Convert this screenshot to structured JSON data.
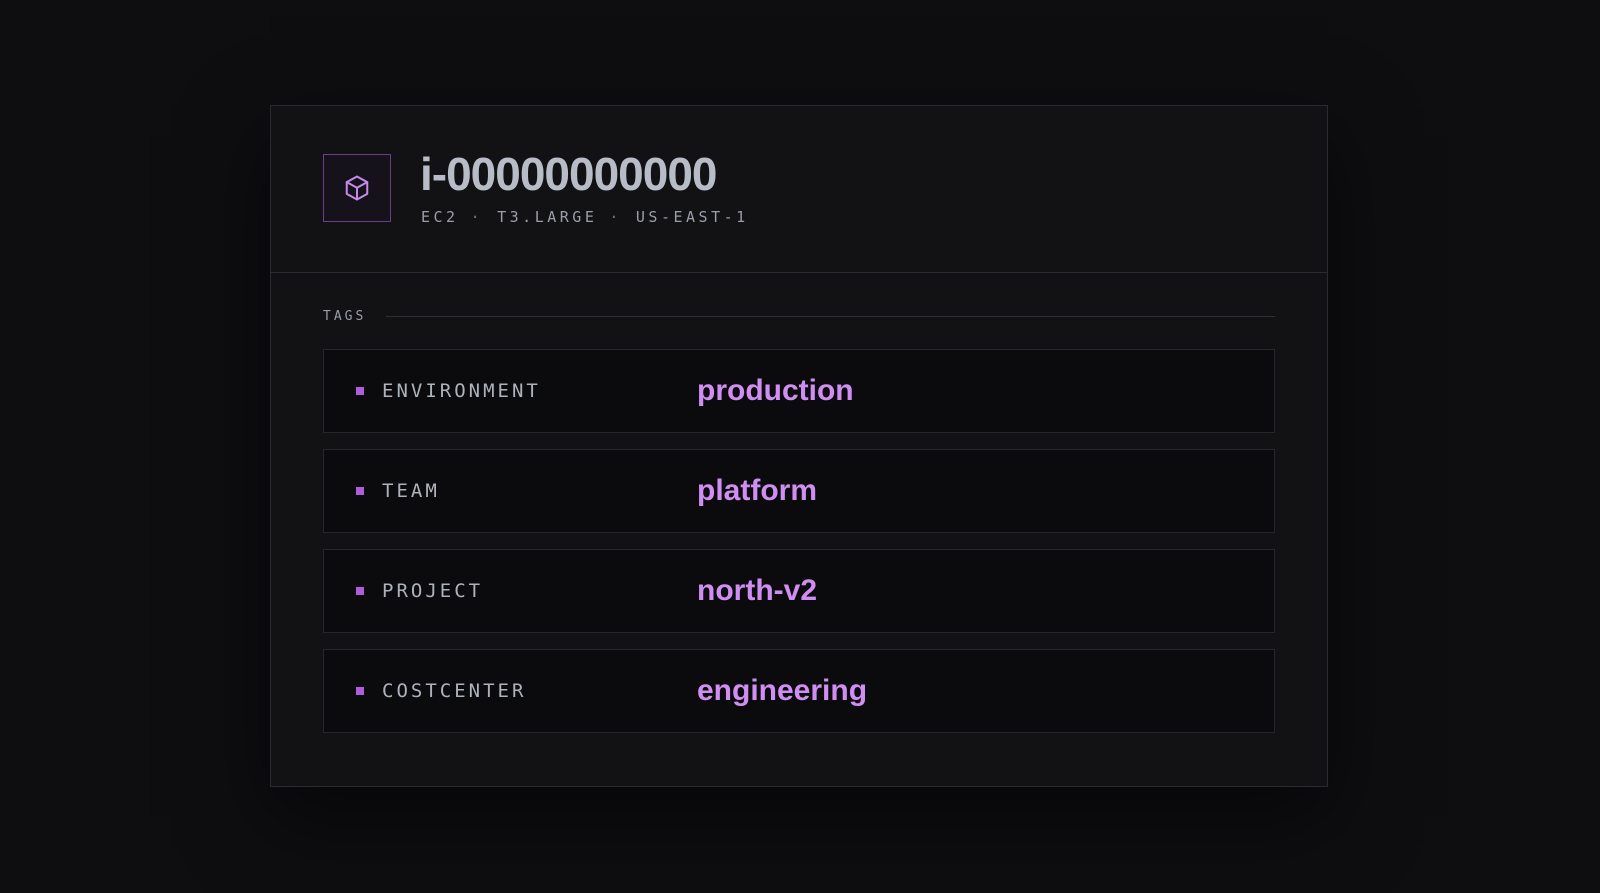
{
  "resource": {
    "icon": "cube-icon",
    "accent_color": "#b05bdc",
    "instance_id": "i-00000000000",
    "service": "EC2",
    "instance_type": "T3.LARGE",
    "region": "US-EAST-1",
    "separator": "·"
  },
  "tags": {
    "heading": "TAGS",
    "items": [
      {
        "key": "ENVIRONMENT",
        "value": "production"
      },
      {
        "key": "TEAM",
        "value": "platform"
      },
      {
        "key": "PROJECT",
        "value": "north-v2"
      },
      {
        "key": "COSTCENTER",
        "value": "engineering"
      }
    ]
  }
}
